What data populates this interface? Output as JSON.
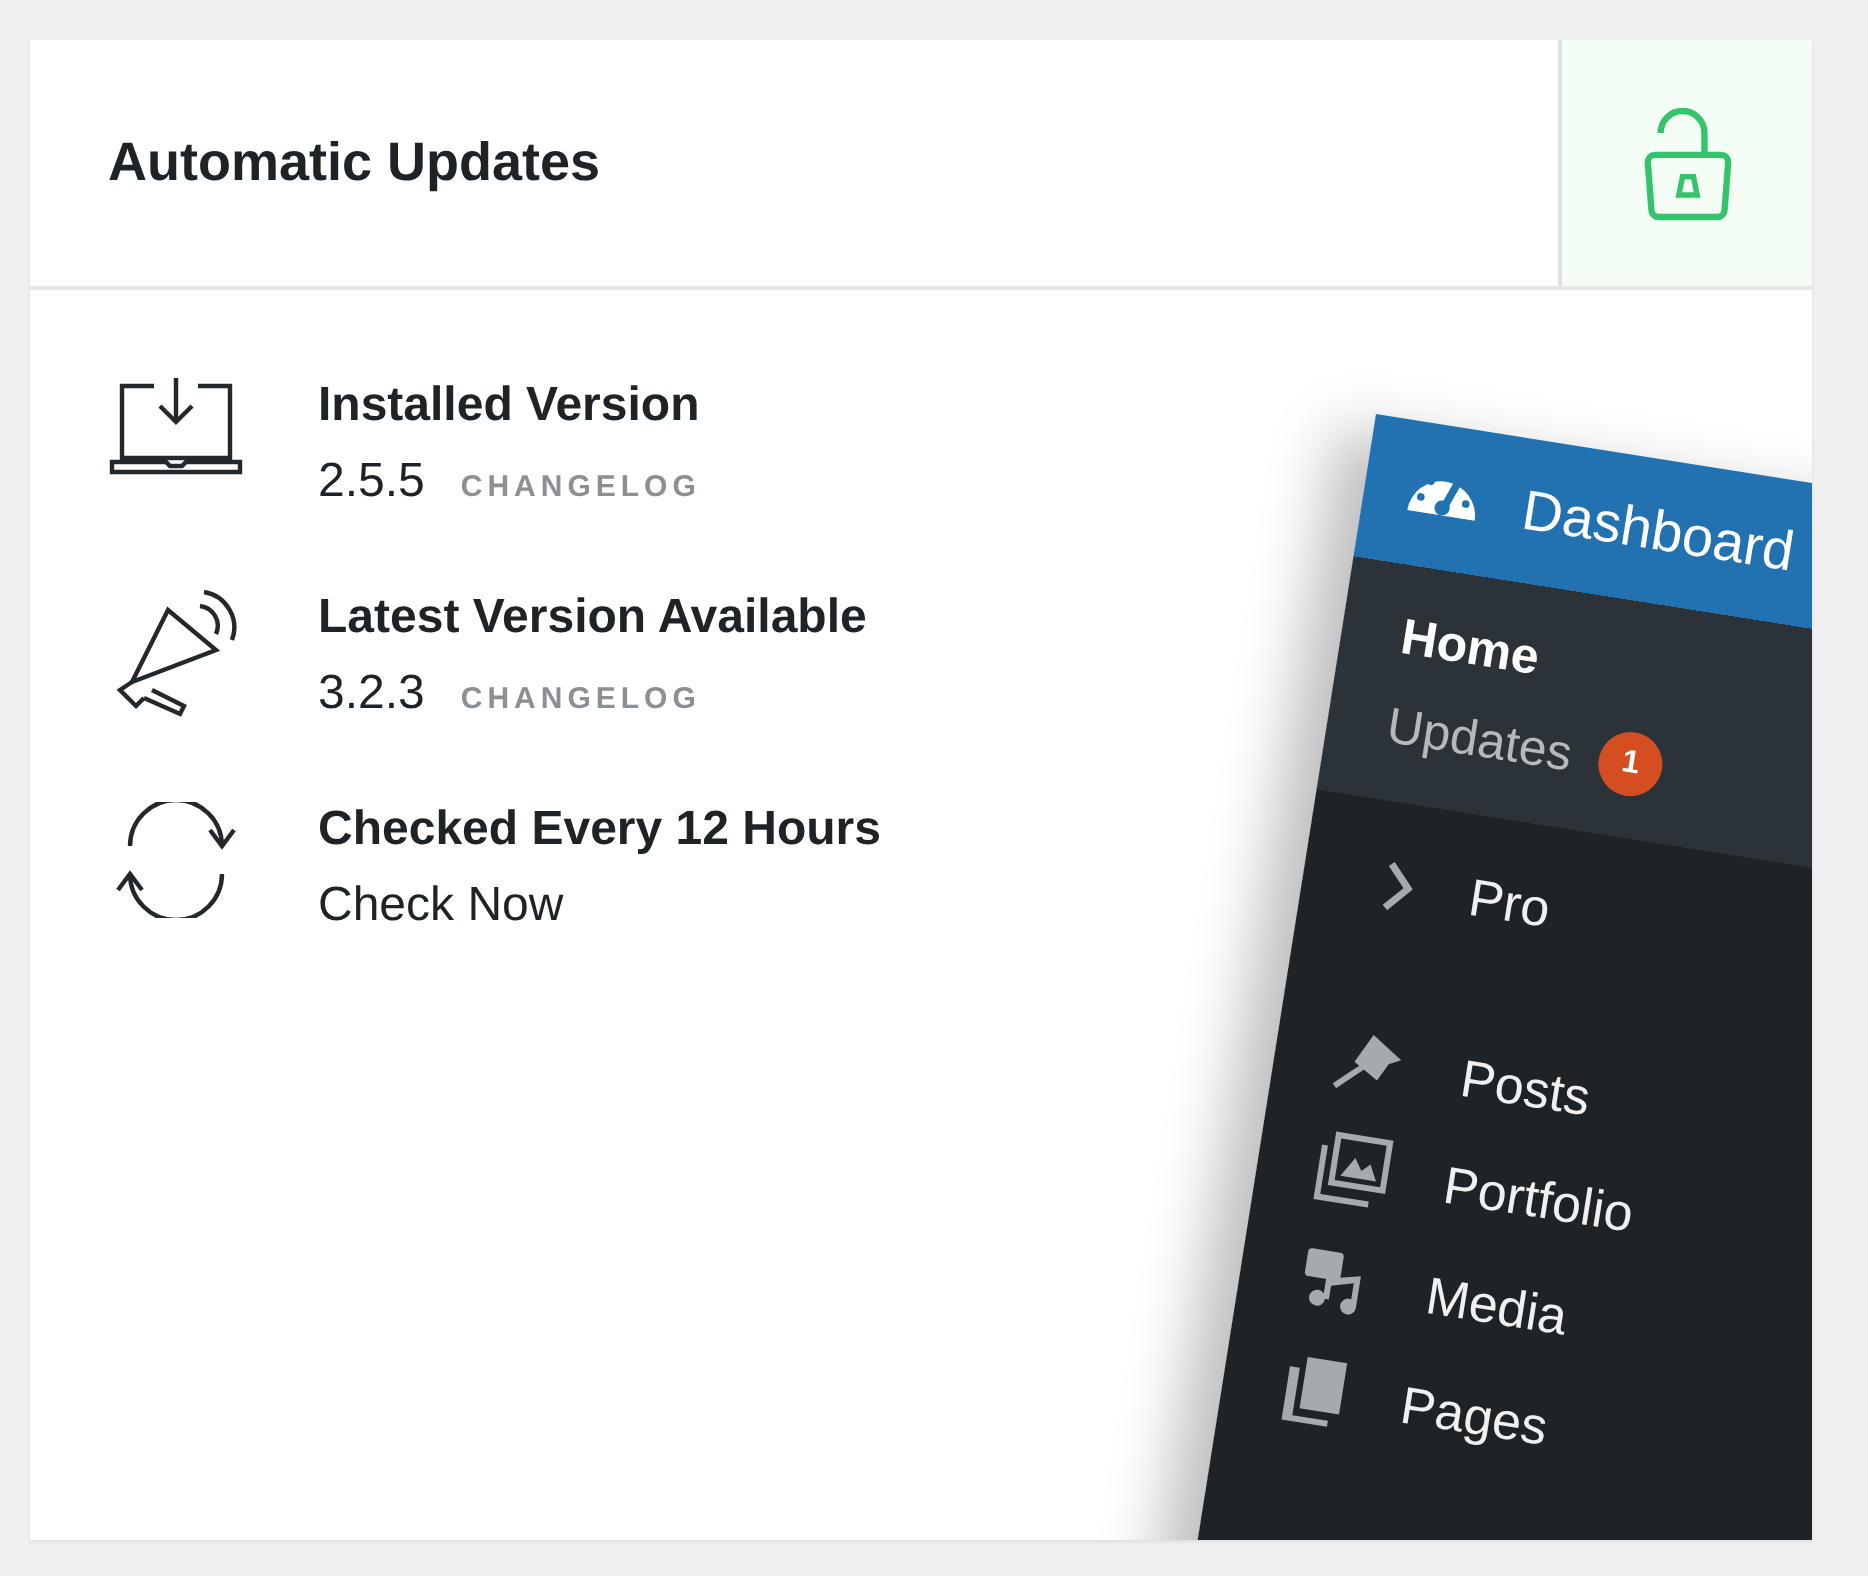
{
  "card": {
    "title": "Automatic Updates",
    "locked": false
  },
  "items": [
    {
      "kind": "installed",
      "title": "Installed Version",
      "version": "2.5.5",
      "link": "CHANGELOG"
    },
    {
      "kind": "latest",
      "title": "Latest Version Available",
      "version": "3.2.3",
      "link": "CHANGELOG"
    },
    {
      "kind": "schedule",
      "title": "Checked Every 12 Hours",
      "action": "Check Now"
    }
  ],
  "admin_menu": {
    "header": "Dashboard",
    "submenu": [
      {
        "label": "Home",
        "selected": true
      },
      {
        "label": "Updates",
        "selected": false,
        "badge": "1"
      }
    ],
    "items": [
      {
        "kind": "chevron",
        "label": "Pro"
      },
      {
        "kind": "pin",
        "label": "Posts"
      },
      {
        "kind": "images",
        "label": "Portfolio"
      },
      {
        "kind": "media",
        "label": "Media"
      },
      {
        "kind": "pages",
        "label": "Pages"
      }
    ]
  }
}
